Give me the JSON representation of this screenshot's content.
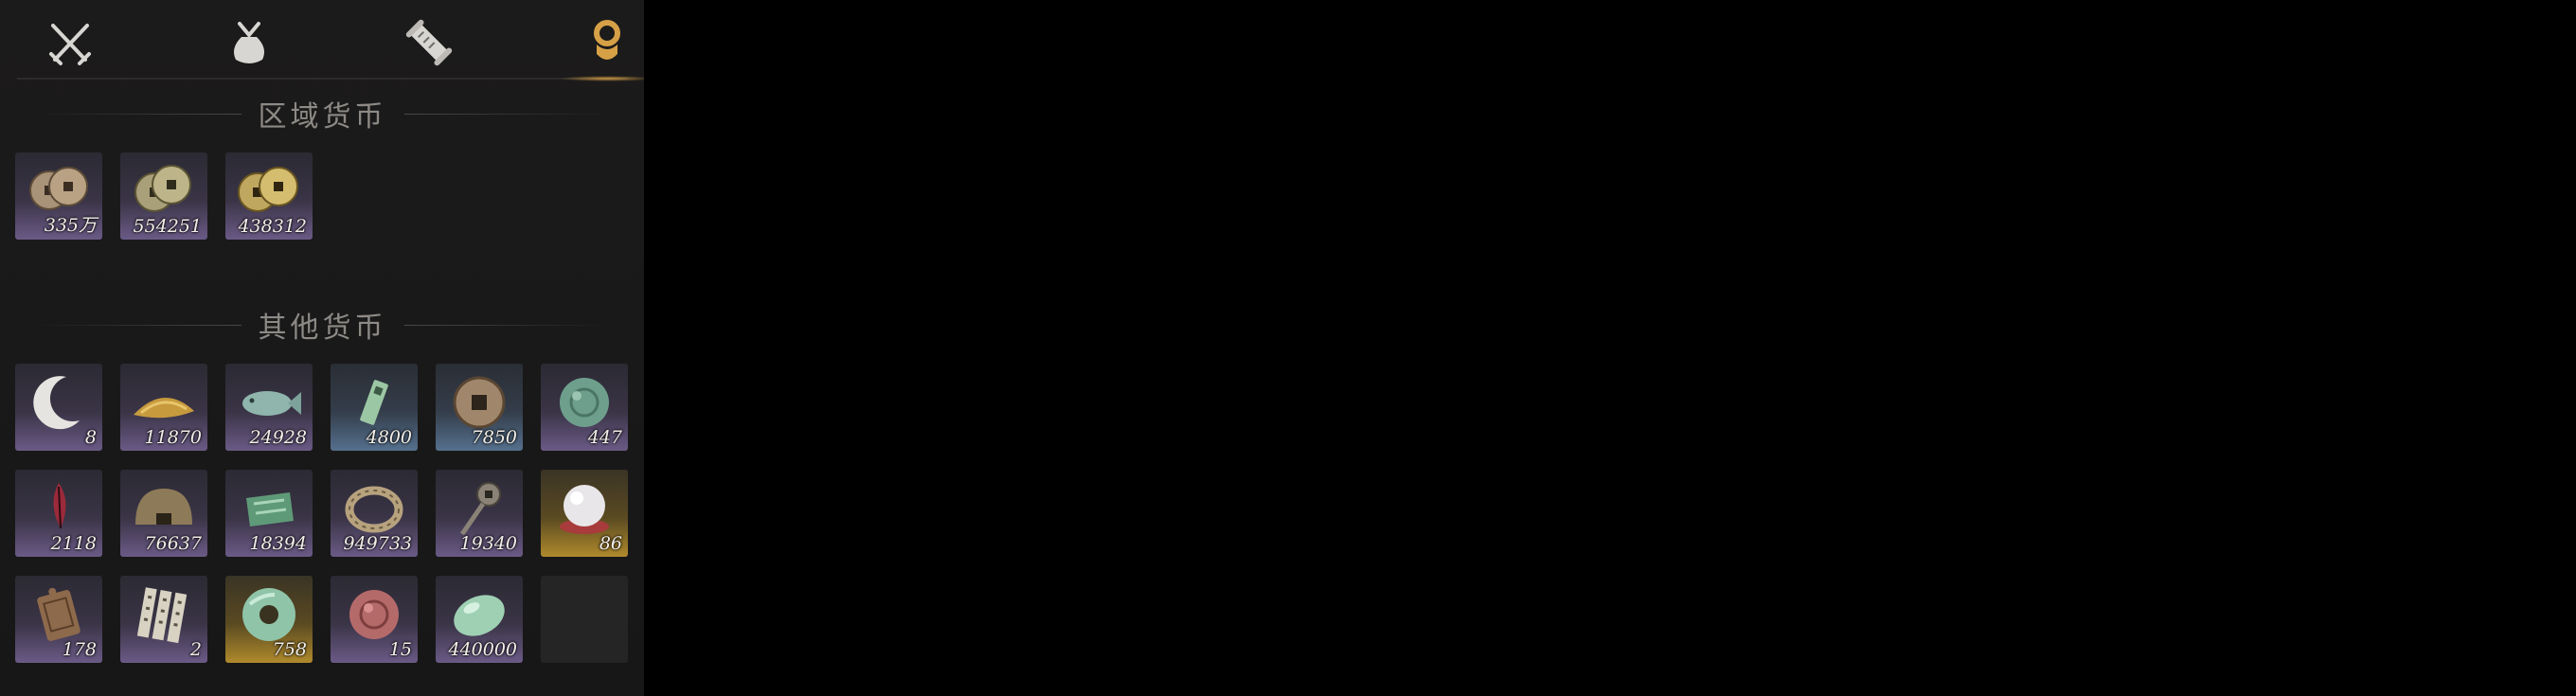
{
  "tabs": [
    {
      "icon": "crossed-swords-icon",
      "active": false
    },
    {
      "icon": "pouch-icon",
      "active": false
    },
    {
      "icon": "scroll-icon",
      "active": false
    },
    {
      "icon": "currency-icon",
      "active": true
    }
  ],
  "accent_color": "#d6a046",
  "sections": {
    "regional": {
      "title": "区域货币",
      "items": [
        {
          "icon": "copper-coins-icon",
          "count": "335万",
          "rarity": "purple"
        },
        {
          "icon": "brass-coins-icon",
          "count": "554251",
          "rarity": "purple"
        },
        {
          "icon": "gold-coins-icon",
          "count": "438312",
          "rarity": "purple"
        }
      ]
    },
    "other": {
      "title": "其他货币",
      "items": [
        {
          "icon": "crescent-moon-icon",
          "count": "8",
          "rarity": "purple"
        },
        {
          "icon": "grain-pile-icon",
          "count": "11870",
          "rarity": "purple"
        },
        {
          "icon": "jade-fish-icon",
          "count": "24928",
          "rarity": "purple"
        },
        {
          "icon": "jade-tablet-icon",
          "count": "4800",
          "rarity": "blue"
        },
        {
          "icon": "square-hole-coin-icon",
          "count": "7850",
          "rarity": "blue"
        },
        {
          "icon": "jade-disc-icon",
          "count": "447",
          "rarity": "purple"
        },
        {
          "icon": "red-feather-icon",
          "count": "2118",
          "rarity": "purple"
        },
        {
          "icon": "bronze-dome-icon",
          "count": "76637",
          "rarity": "purple"
        },
        {
          "icon": "green-cloth-icon",
          "count": "18394",
          "rarity": "purple"
        },
        {
          "icon": "coiled-rope-icon",
          "count": "949733",
          "rarity": "purple"
        },
        {
          "icon": "key-coin-icon",
          "count": "19340",
          "rarity": "purple"
        },
        {
          "icon": "pearl-icon",
          "count": "86",
          "rarity": "gold"
        },
        {
          "icon": "bronze-plaque-icon",
          "count": "178",
          "rarity": "purple"
        },
        {
          "icon": "bamboo-slips-icon",
          "count": "2",
          "rarity": "purple"
        },
        {
          "icon": "jade-bi-icon",
          "count": "758",
          "rarity": "gold"
        },
        {
          "icon": "red-jade-icon",
          "count": "15",
          "rarity": "purple"
        },
        {
          "icon": "jade-pebble-icon",
          "count": "440000",
          "rarity": "purple"
        },
        {
          "icon": "empty-slot",
          "count": "",
          "rarity": "empty"
        }
      ]
    }
  }
}
